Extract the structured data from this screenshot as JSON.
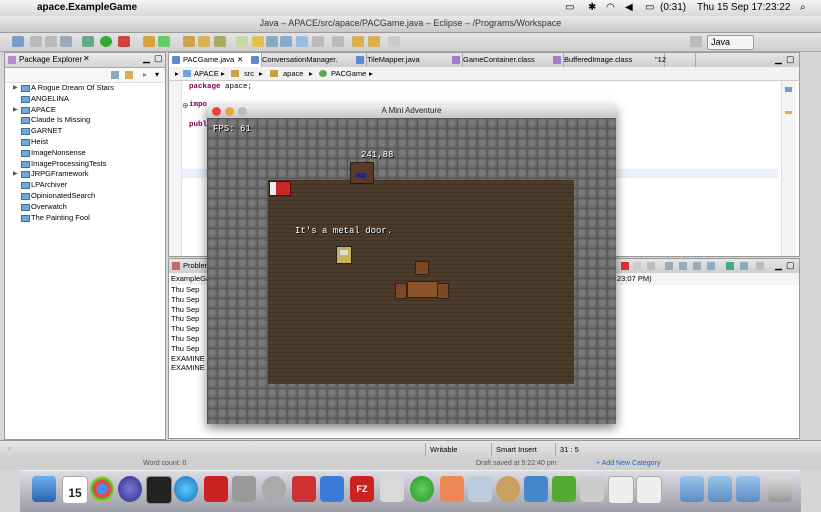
{
  "menubar": {
    "app_name": "apace.ExampleGame",
    "battery": "(0:31)",
    "datetime": "Thu 15 Sep  17:23:22"
  },
  "window": {
    "title": "Java – APACE/src/apace/PACGame.java – Eclipse – /Programs/Workspace",
    "perspective": "Java"
  },
  "package_explorer": {
    "title": "Package Explorer",
    "projects": [
      {
        "label": "A Rogue Dream Of Stars",
        "expandable": true
      },
      {
        "label": "ANGELINA",
        "expandable": false
      },
      {
        "label": "APACE",
        "expandable": true
      },
      {
        "label": "Claude Is Missing",
        "expandable": false
      },
      {
        "label": "GARNET",
        "expandable": false
      },
      {
        "label": "Heist",
        "expandable": false
      },
      {
        "label": "ImageNonsense",
        "expandable": false
      },
      {
        "label": "ImageProcessingTests",
        "expandable": false
      },
      {
        "label": "JRPGFramework",
        "expandable": true
      },
      {
        "label": "LPArchiver",
        "expandable": false
      },
      {
        "label": "OpinionatedSearch",
        "expandable": false
      },
      {
        "label": "Overwatch",
        "expandable": false
      },
      {
        "label": "The Painting Fool",
        "expandable": false
      }
    ]
  },
  "editor": {
    "tabs": [
      {
        "label": "PACGame.java",
        "active": true
      },
      {
        "label": "ConversationManager.",
        "active": false
      },
      {
        "label": "TileMapper.java",
        "active": false
      },
      {
        "label": "GameContainer.class",
        "active": false
      },
      {
        "label": "BufferedImage.class",
        "active": false
      },
      {
        "label": "\"12",
        "active": false
      }
    ],
    "breadcrumb": [
      "APACE",
      "src",
      "apace",
      "PACGame"
    ],
    "code": {
      "line1_kw": "package",
      "line1_rest": " apace;",
      "line2": "impo",
      "line3": "publ"
    }
  },
  "console": {
    "tab_label": "Problen",
    "header_left": "ExampleGa",
    "header_right": "23:07 PM)",
    "lines": [
      "Thu  Sep",
      "Thu  Sep",
      "Thu  Sep",
      "Thu  Sep",
      "Thu  Sep",
      "Thu  Sep",
      "Thu  Sep",
      "EXAMINE",
      "EXAMINE"
    ]
  },
  "statusbar": {
    "writable": "Writable",
    "insert_mode": "Smart Insert",
    "position": "31 : 5"
  },
  "behind": {
    "word_count": "Word count: 0",
    "draft": "Draft saved at 5:22:40 pm",
    "add_category": "+ Add New Category"
  },
  "game": {
    "title": "A Mini Adventure",
    "fps": "FPS: 61",
    "coords": "241,88",
    "message": "It's a metal door."
  },
  "dock": {
    "calendar_day": "15"
  }
}
